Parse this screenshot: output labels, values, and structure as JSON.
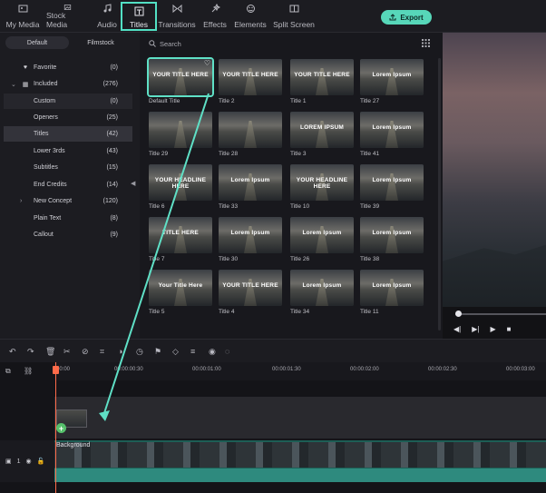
{
  "topbar": {
    "tabs": [
      {
        "label": "My Media",
        "icon": "media-icon"
      },
      {
        "label": "Stock Media",
        "icon": "stock-icon"
      },
      {
        "label": "Audio",
        "icon": "music-icon"
      },
      {
        "label": "Titles",
        "icon": "titles-icon",
        "active": true
      },
      {
        "label": "Transitions",
        "icon": "transitions-icon"
      },
      {
        "label": "Effects",
        "icon": "effects-icon"
      },
      {
        "label": "Elements",
        "icon": "elements-icon"
      },
      {
        "label": "Split Screen",
        "icon": "split-screen-icon"
      }
    ],
    "export_label": "Export"
  },
  "sidebar": {
    "segments": [
      "Default",
      "Filmstock"
    ],
    "items": [
      {
        "label": "Favorite",
        "count": "(0)",
        "icon": "heart-icon"
      },
      {
        "label": "Included",
        "count": "(276)",
        "icon": "grid-icon"
      },
      {
        "label": "Custom",
        "count": "(0)"
      },
      {
        "label": "Openers",
        "count": "(25)"
      },
      {
        "label": "Titles",
        "count": "(42)"
      },
      {
        "label": "Lower 3rds",
        "count": "(43)"
      },
      {
        "label": "Subtitles",
        "count": "(15)"
      },
      {
        "label": "End Credits",
        "count": "(14)"
      },
      {
        "label": "New Concept",
        "count": "(120)"
      },
      {
        "label": "Plain Text",
        "count": "(8)"
      },
      {
        "label": "Callout",
        "count": "(9)"
      }
    ]
  },
  "content": {
    "search_placeholder": "Search",
    "cards": [
      {
        "label": "Default Title",
        "overlay": "YOUR TITLE HERE"
      },
      {
        "label": "Title 2",
        "overlay": "YOUR TITLE HERE"
      },
      {
        "label": "Title 1",
        "overlay": "YOUR TITLE HERE"
      },
      {
        "label": "Title 27",
        "overlay": "Lorem Ipsum"
      },
      {
        "label": "Title 29",
        "overlay": ""
      },
      {
        "label": "Title 28",
        "overlay": ""
      },
      {
        "label": "Title 3",
        "overlay": "LOREM IPSUM"
      },
      {
        "label": "Title 41",
        "overlay": "Lorem Ipsum"
      },
      {
        "label": "Title 6",
        "overlay": "YOUR HEADLINE HERE"
      },
      {
        "label": "Title 33",
        "overlay": "Lorem Ipsum"
      },
      {
        "label": "Title 10",
        "overlay": "YOUR HEADLINE HERE"
      },
      {
        "label": "Title 39",
        "overlay": "Lorem Ipsum"
      },
      {
        "label": "Title 7",
        "overlay": "TITLE HERE"
      },
      {
        "label": "Title 30",
        "overlay": "Lorem Ipsum"
      },
      {
        "label": "Title 26",
        "overlay": "Lorem Ipsum"
      },
      {
        "label": "Title 38",
        "overlay": "Lorem Ipsum"
      },
      {
        "label": "Title 5",
        "overlay": "Your Title Here"
      },
      {
        "label": "Title 4",
        "overlay": "YOUR TITLE HERE"
      },
      {
        "label": "Title 34",
        "overlay": "Lorem Ipsum"
      },
      {
        "label": "Title 11",
        "overlay": "Lorem Ipsum"
      }
    ]
  },
  "timeline": {
    "ruler": [
      "00:00",
      "00:00:00:30",
      "00:00:01:00",
      "00:00:01:30",
      "00:00:02:00",
      "00:00:02:30",
      "00:00:03:00"
    ],
    "video_clip_label": "Background",
    "track_label": "1"
  }
}
